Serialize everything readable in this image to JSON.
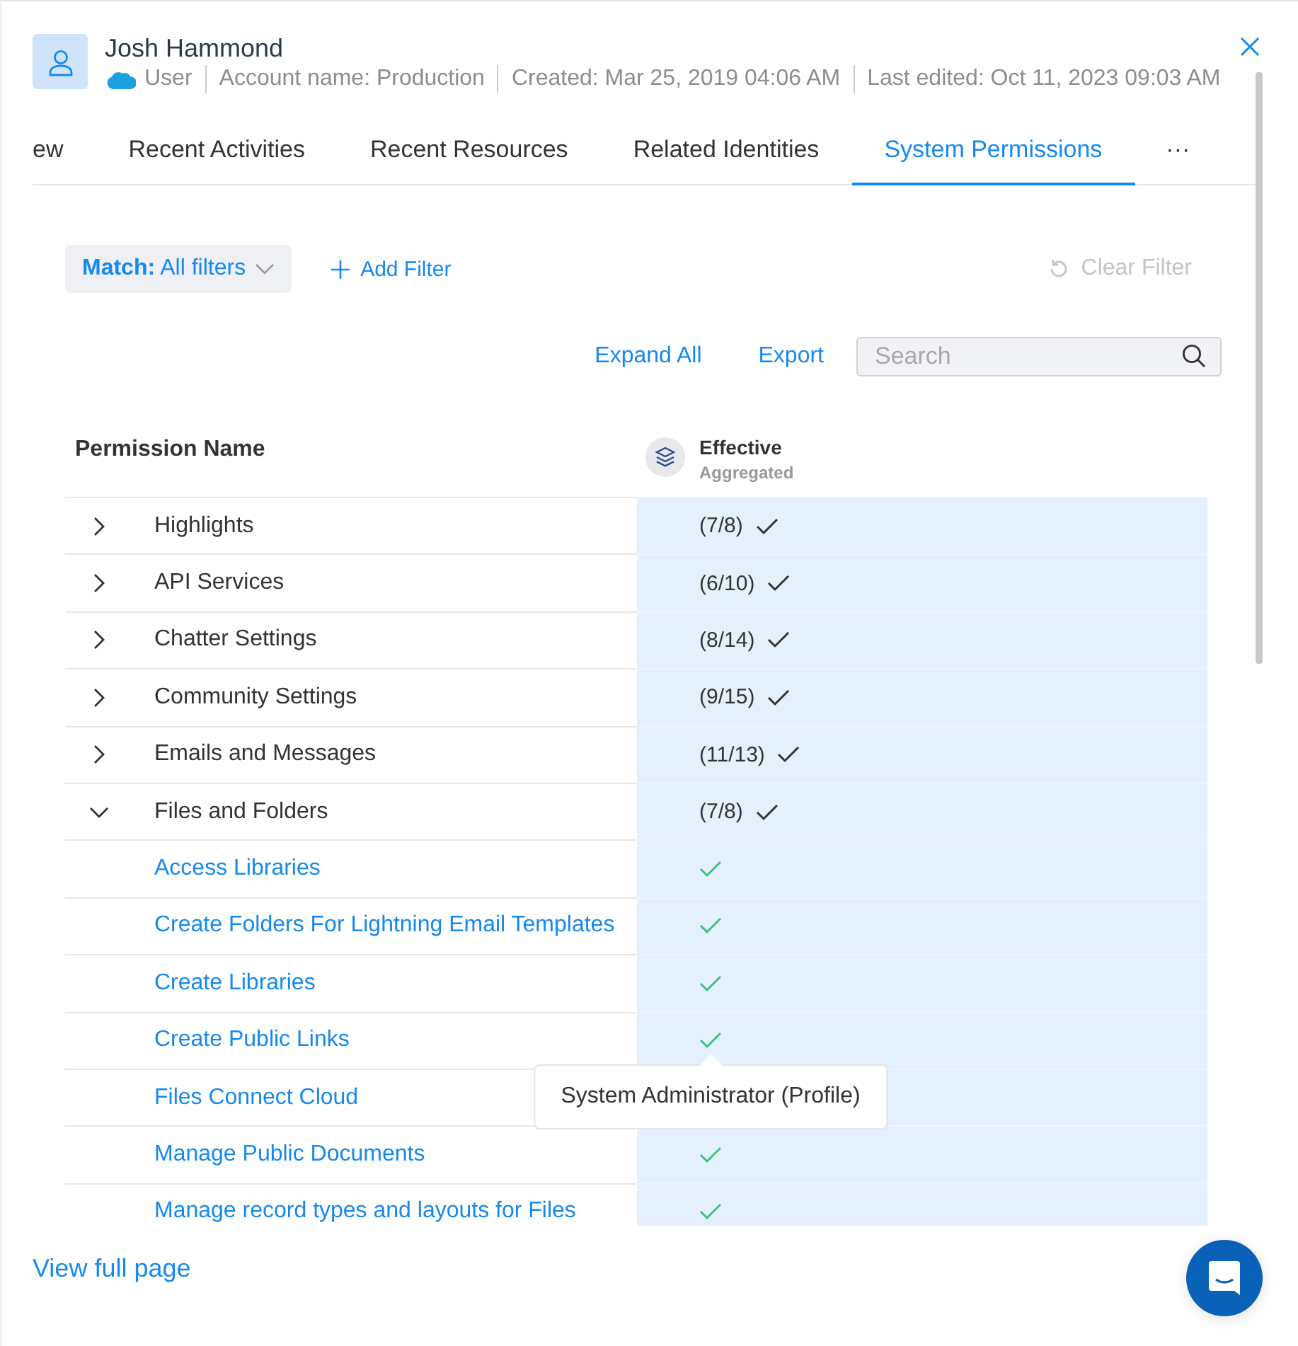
{
  "header": {
    "name": "Josh Hammond",
    "meta": [
      "User",
      "Account name: Production",
      "Created: Mar 25, 2019 04:06 AM",
      "Last edited: Oct 11, 2023 09:03 AM"
    ]
  },
  "tabs": [
    {
      "label": "ew",
      "selected": false
    },
    {
      "label": "Recent Activities",
      "selected": false
    },
    {
      "label": "Recent Resources",
      "selected": false
    },
    {
      "label": "Related Identities",
      "selected": false
    },
    {
      "label": "System Permissions",
      "selected": true
    }
  ],
  "more": "···",
  "filter": {
    "match_label": "Match:",
    "match_value": "All filters",
    "add_label": "Add Filter"
  },
  "clear_filter": {
    "label": "Clear Filter",
    "disabled": true
  },
  "actions": [
    "Expand All",
    "Export"
  ],
  "search": {
    "placeholder": "Search"
  },
  "table": {
    "columns": [
      {
        "title": "Permission Name"
      },
      {
        "title": "Effective",
        "subtitle": "Aggregated"
      }
    ],
    "rows": [
      {
        "name": "Highlights",
        "count": "(7/8)",
        "granted": true,
        "expanded": false
      },
      {
        "name": "API Services",
        "count": "(6/10)",
        "granted": true,
        "expanded": false
      },
      {
        "name": "Chatter Settings",
        "count": "(8/14)",
        "granted": true,
        "expanded": false
      },
      {
        "name": "Community Settings",
        "count": "(9/15)",
        "granted": true,
        "expanded": false
      },
      {
        "name": "Emails and Messages",
        "count": "(11/13)",
        "granted": true,
        "expanded": false
      },
      {
        "name": "Files and Folders",
        "count": "(7/8)",
        "granted": true,
        "expanded": true,
        "children": [
          {
            "name": "Access Libraries",
            "granted": true
          },
          {
            "name": "Create Folders For Lightning Email Templates",
            "granted": true
          },
          {
            "name": "Create Libraries",
            "granted": true
          },
          {
            "name": "Create Public Links",
            "granted": true,
            "tooltip": "System Administrator (Profile)"
          },
          {
            "name": "Files Connect Cloud"
          },
          {
            "name": "Manage Public Documents",
            "granted": true
          },
          {
            "name": "Manage record types and layouts for Files",
            "granted": true
          }
        ]
      }
    ]
  },
  "footer_link": "View full page"
}
